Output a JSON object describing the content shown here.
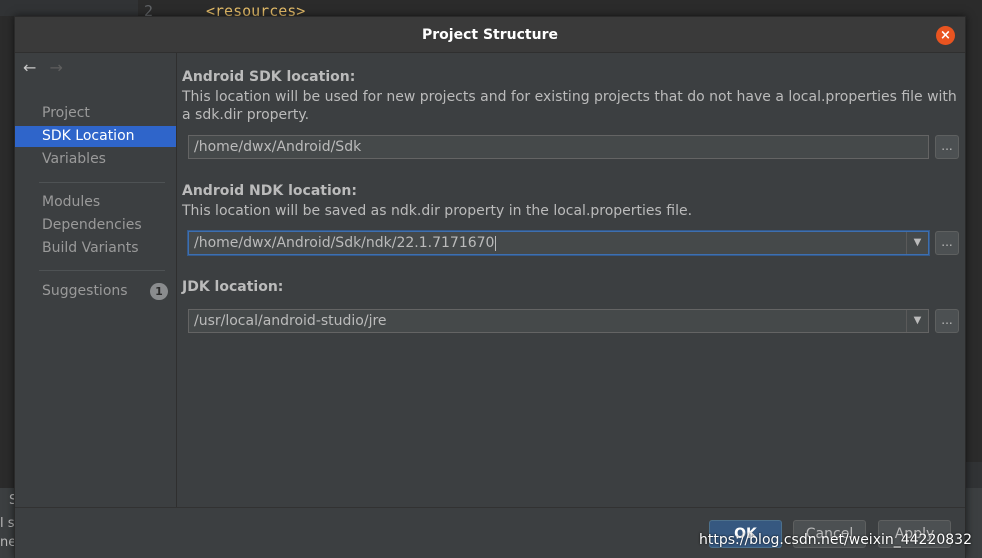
{
  "background": {
    "line_number": "2",
    "code_line": "<resources>",
    "bottom_text_1": "l su",
    "bottom_text_2": "ne",
    "bottom_text_3": "S"
  },
  "dialog": {
    "title": "Project Structure",
    "close_glyph": "×"
  },
  "sidebar": {
    "back_glyph": "←",
    "forward_glyph": "→",
    "items": [
      {
        "label": "Project"
      },
      {
        "label": "SDK Location",
        "selected": true
      },
      {
        "label": "Variables"
      },
      {
        "label": "Modules"
      },
      {
        "label": "Dependencies"
      },
      {
        "label": "Build Variants"
      },
      {
        "label": "Suggestions",
        "badge": "1"
      }
    ]
  },
  "sdk": {
    "title": "Android SDK location:",
    "description": "This location will be used for new projects and for existing projects that do not have a local.properties file with a sdk.dir property.",
    "value": "/home/dwx/Android/Sdk",
    "browse_label": "..."
  },
  "ndk": {
    "title": "Android NDK location:",
    "description": "This location will be saved as ndk.dir property in the local.properties file.",
    "value": "/home/dwx/Android/Sdk/ndk/22.1.7171670",
    "browse_label": "..."
  },
  "jdk": {
    "title": "JDK location:",
    "value": "/usr/local/android-studio/jre",
    "browse_label": "..."
  },
  "footer": {
    "ok_label": "OK",
    "cancel_label": "Cancel",
    "apply_label": "Apply"
  },
  "watermark": "https://blog.csdn.net/weixin_44220832",
  "colors": {
    "accent": "#2f65ca",
    "close": "#e95420",
    "ok_button": "#365880",
    "dialog_bg": "#3c3f41"
  }
}
